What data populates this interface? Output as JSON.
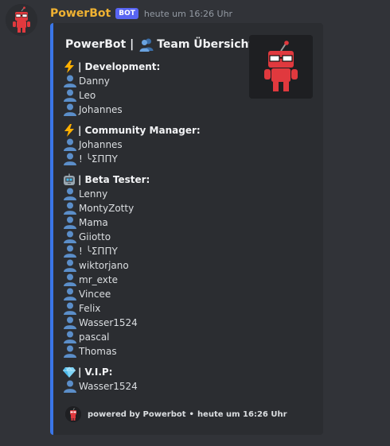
{
  "message": {
    "username": "PowerBot",
    "bot_tag": "BOT",
    "timestamp": "heute um 16:26 Uhr"
  },
  "embed": {
    "accent_color": "#3a76e8",
    "title_prefix": "PowerBot |",
    "title_icon": "team-people-icon",
    "title_suffix": "Team Übersicht:",
    "fields": [
      {
        "icon": "lightning-icon",
        "name": "| Development:",
        "members": [
          "Danny",
          "Leo",
          "Johannes"
        ]
      },
      {
        "icon": "lightning-icon",
        "name": "| Community Manager:",
        "members": [
          "Johannes",
          "! ╰ΣΠΠΥ"
        ]
      },
      {
        "icon": "robot-icon",
        "name": "| Beta Tester:",
        "members": [
          "Lenny",
          "MontyZotty",
          "Mama",
          "Giiotto",
          "! ╰ΣΠΠΥ",
          "wiktorjano",
          "mr_exte",
          "Vincee",
          "Felix",
          "Wasser1524",
          "pascal",
          "Thomas"
        ]
      },
      {
        "icon": "gem-icon",
        "name": "| V.I.P:",
        "members": [
          "Wasser1524"
        ]
      }
    ],
    "footer_text": "powered by Powerbot",
    "footer_separator": "•",
    "footer_timestamp": "heute um 16:26 Uhr"
  }
}
